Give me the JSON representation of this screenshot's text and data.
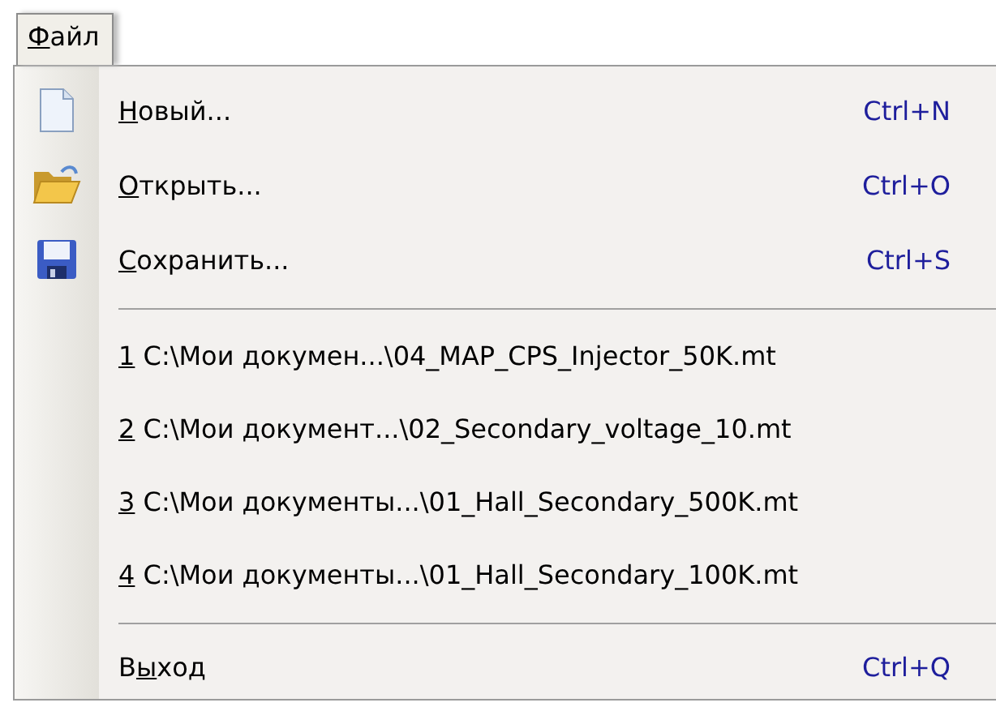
{
  "menu_bar": [
    {
      "key": "Ф",
      "after": "айл",
      "selected": true
    }
  ],
  "menu": {
    "items": [
      {
        "kind": "command",
        "key": "Н",
        "after": "овый...",
        "shortcut": "Ctrl+N"
      },
      {
        "kind": "command",
        "key": "О",
        "after": "ткрыть...",
        "shortcut": "Ctrl+O"
      },
      {
        "kind": "command",
        "key": "С",
        "after": "охранить...",
        "shortcut": "Ctrl+S"
      },
      {
        "kind": "separator"
      },
      {
        "kind": "recent",
        "key": "1",
        "after": " C:\\Мои докумен...\\04_MAP_CPS_Injector_50K.mt"
      },
      {
        "kind": "recent",
        "key": "2",
        "after": " C:\\Мои документ...\\02_Secondary_voltage_10.mt"
      },
      {
        "kind": "recent",
        "key": "3",
        "after": " C:\\Мои документы...\\01_Hall_Secondary_500K.mt"
      },
      {
        "kind": "recent",
        "key": "4",
        "after": " C:\\Мои документы...\\01_Hall_Secondary_100K.mt"
      },
      {
        "kind": "separator"
      },
      {
        "kind": "command",
        "before": "В",
        "key": "ы",
        "after": "ход",
        "shortcut": "Ctrl+Q"
      }
    ]
  }
}
